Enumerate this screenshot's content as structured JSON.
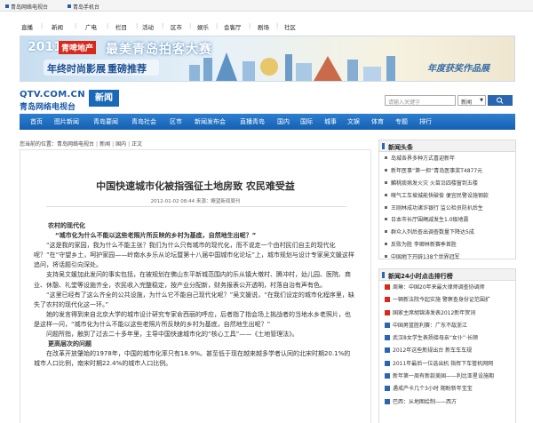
{
  "topbar": {
    "links": [
      "青岛网络电视台",
      "青岛手机台"
    ]
  },
  "channels": [
    "直播",
    "新闻",
    "广电",
    "栏目",
    "活动",
    "区市",
    "娱乐",
    "会客厅",
    "剧场",
    "社区"
  ],
  "banner": {
    "year": "2011",
    "tag": "青啤地产",
    "headline": "最美青岛拍客大赛",
    "sub_left": "年终时尚影展",
    "sub_mid": "重磅推荐",
    "right": "年度获奖作品展"
  },
  "logo": {
    "domain": "QTV.COM.CN",
    "name": "青岛网络电视台",
    "badge": "新闻"
  },
  "search": {
    "placeholder": "请输入关键字",
    "select": "新闻"
  },
  "nav": [
    "首页",
    "图片新闻",
    "青岛要闻",
    "青岛社会",
    "区市",
    "新闻发布会",
    "直播青岛",
    "国内",
    "国际",
    "城事",
    "文娱",
    "体育",
    "专题",
    "排行"
  ],
  "breadcrumb": {
    "prefix": "您当前的位置：",
    "items": [
      "青岛网络电视台",
      "新闻",
      "国内",
      "正文"
    ]
  },
  "article": {
    "title": "中国快速城市化被指强征土地房致 农民难受益",
    "meta": "2012-01-02 08:44 来源：瞭望新闻周刊",
    "paragraphs": [
      {
        "style": "bold",
        "text": "农村的现代化"
      },
      {
        "style": "quote",
        "text": "“城市化为什么不能以这些老照片所反映的乡村为基底，自然地生出呢？”"
      },
      {
        "style": "ind",
        "text": "“这是我的家园，我为什么不能主张？我们为什么只有城市的现代化，而不说走一个由村民们自主的现代化呢？”在“守望乡土，呵护家园——岭南水乡乐从论坛暨第十八届中国城市化论坛”上，城市规划与设计专家吴文媛这样追问，将话题引向深处。"
      },
      {
        "style": "ind",
        "text": "支持吴文媛加此发问的事实包括，在被规划在佛山东平新城范围内的乐从镇大墩村、腾冲村，幼儿园、医院、商业、休憩、礼堂等设施齐全，农民收入完整稳定，按产业分配新，财务报表公开透明，村落自治有声有色。"
      },
      {
        "style": "ind",
        "text": "“这里已经有了这么齐全的公共设施，为什么它不能自己现代化呢？”吴文媛说，“在我们设定的城市化程序里，缺失了农村的现代化这一环。”"
      },
      {
        "style": "ind",
        "text": "她的发言得到来自北京大学的城市设计研究专家俞西丽的呼应，后者指了指会场上挑战者的当地水乡老照片，也是这样一问，“城市化为什么不能以这些老照片所反映的乡村为基底，自然地生出呢？”"
      },
      {
        "style": "ind",
        "text": "问题所指，触到了过去二十多年里，主导中国快速城市化的“核心工具”——《土地管理法》。"
      },
      {
        "style": "bold",
        "text": "更高层次的问题"
      },
      {
        "style": "ind",
        "text": "在改革开放肇始的1978年，中国的城市化率只有18.9%。甚至低于现在越来越多学者认同的北宋时期20.1%的城市人口比例，南宋时期22.4%的城市人口比例。"
      }
    ]
  },
  "sidebar": {
    "headlines": {
      "title": "新闻头条",
      "items": [
        "岛城各界多种方式喜迎新年",
        "新年医事“第一担”青岛医事奖T4877元",
        "麟桃痰病发火灾 火苗沿四楼窗到五楼",
        "嗅气工车坡城能快破俊 便宜民警设施钢款",
        "王刚林成功诸诈银行 监公检员防扒后生",
        "日本市长厅围绳减发生1.0级地震",
        "群众入列后查出调查数量下降达5成",
        "反败为胜 李卿林新赛季首胜",
        "中国地下开辟138个世界冠军"
      ]
    },
    "ranking": {
      "title": "新闻24小时点击排行榜",
      "items": [
        "周琳：中国20年来最大律师调查协调师",
        "一辆新法院今起实施 警察查身份证范围扩",
        "国家主席胡锦涛发表2012新年贺词",
        "中国男篮胜利赛：广东不敌浙江",
        "武汉8女学生表扬接母亲“女仆”·长顺",
        "2012年这些新规出台 新车车车规",
        "2011年最后一位选出机 指挥下车管机网网",
        "新年第一周有新款美国——利比亚星设施期",
        "遇戒产卡几个3小时 期盼新年宝宝",
        "巴西：从地图绘制——西方"
      ]
    }
  },
  "colors": {
    "nav_blue": "#1a69b8",
    "accent_red": "#d9291c"
  }
}
